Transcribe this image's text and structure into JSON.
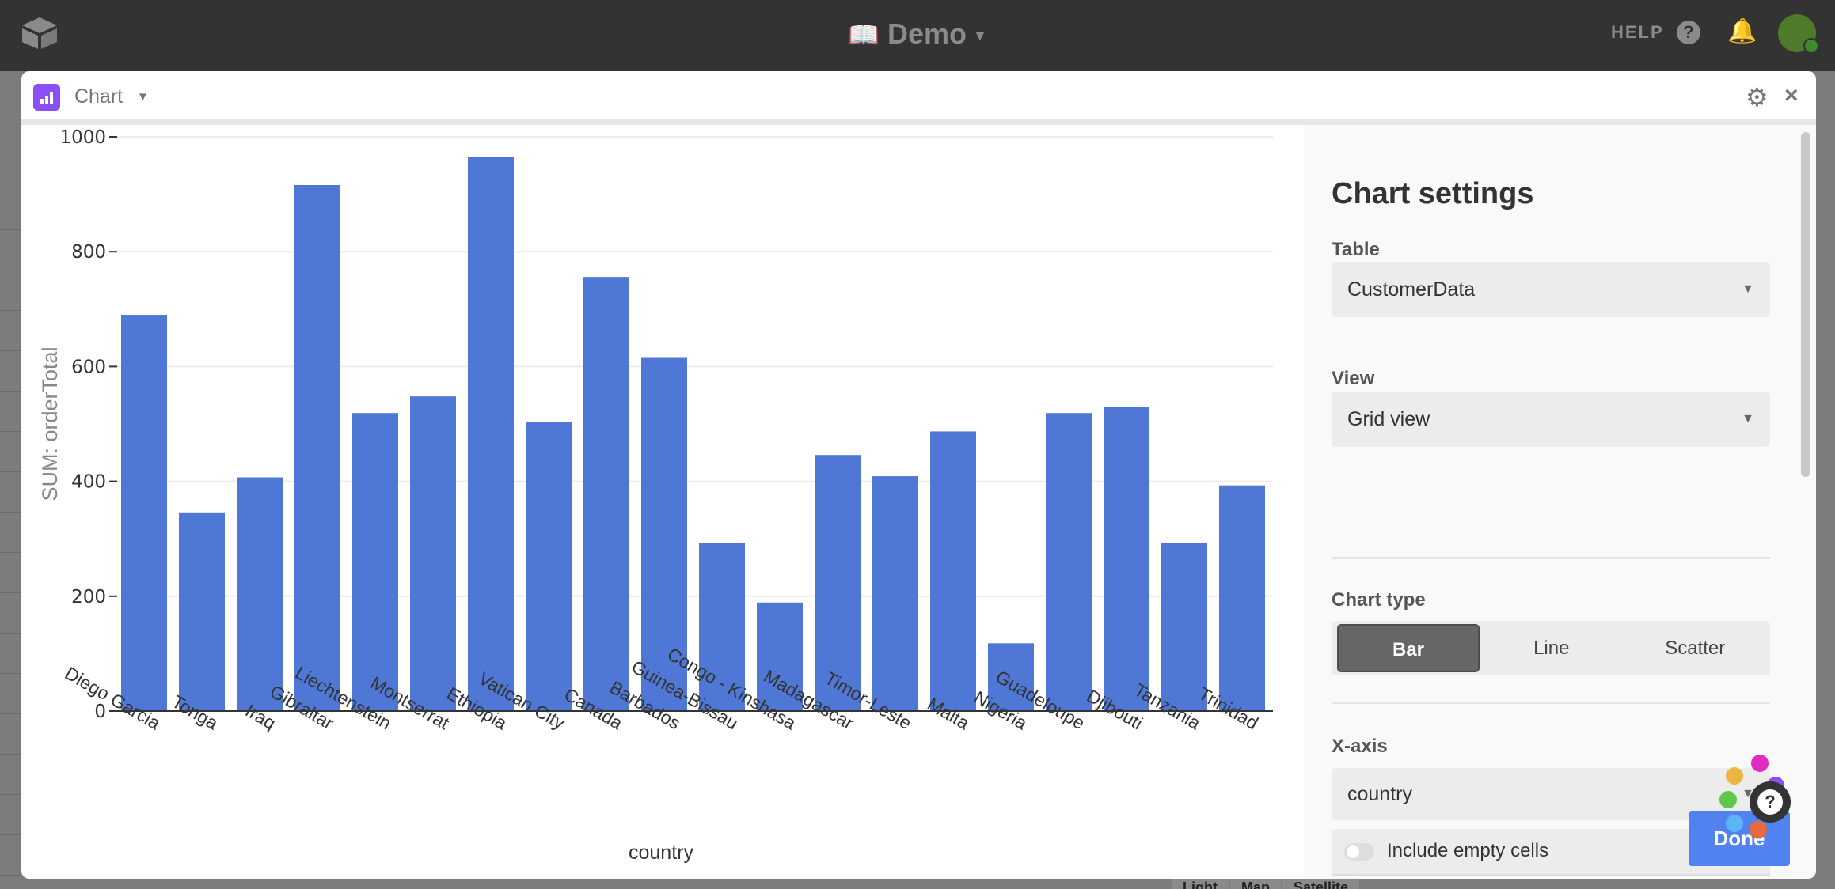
{
  "topbar": {
    "base_title": "Demo",
    "help_label": "HELP"
  },
  "modal": {
    "title": "Chart"
  },
  "background": {
    "tabs": [
      "Light",
      "Map",
      "Satellite"
    ]
  },
  "settings": {
    "title": "Chart settings",
    "table_label": "Table",
    "table_value": "CustomerData",
    "view_label": "View",
    "view_value": "Grid view",
    "chart_type_label": "Chart type",
    "chart_types": [
      "Bar",
      "Line",
      "Scatter"
    ],
    "chart_type_selected": "Bar",
    "xaxis_label": "X-axis",
    "xaxis_value": "country",
    "include_empty_label": "Include empty cells",
    "include_empty_on": false,
    "done_label": "Done"
  },
  "colors": {
    "bar": "#4f78d6",
    "accent": "#8b4ef7",
    "done": "#5182f0"
  },
  "chart_data": {
    "type": "bar",
    "xlabel": "country",
    "ylabel": "SUM: orderTotal",
    "ylim": [
      0,
      1000
    ],
    "yticks": [
      "0",
      "200",
      "400",
      "600",
      "800",
      "1000"
    ],
    "grid": true,
    "categories": [
      "Diego Garcia",
      "Tonga",
      "Iraq",
      "Gibraltar",
      "Liechtenstein",
      "Montserrat",
      "Ethiopia",
      "Vatican City",
      "Canada",
      "Barbados",
      "Guinea-Bissau",
      "Congo - Kinshasa",
      "Madagascar",
      "Timor-Leste",
      "Malta",
      "Nigeria",
      "Guadeloupe",
      "Djibouti",
      "Tanzania",
      "Trinidad"
    ],
    "values": [
      690,
      346,
      407,
      916,
      519,
      548,
      965,
      503,
      756,
      615,
      293,
      189,
      446,
      409,
      487,
      118,
      519,
      530,
      293,
      393
    ]
  }
}
